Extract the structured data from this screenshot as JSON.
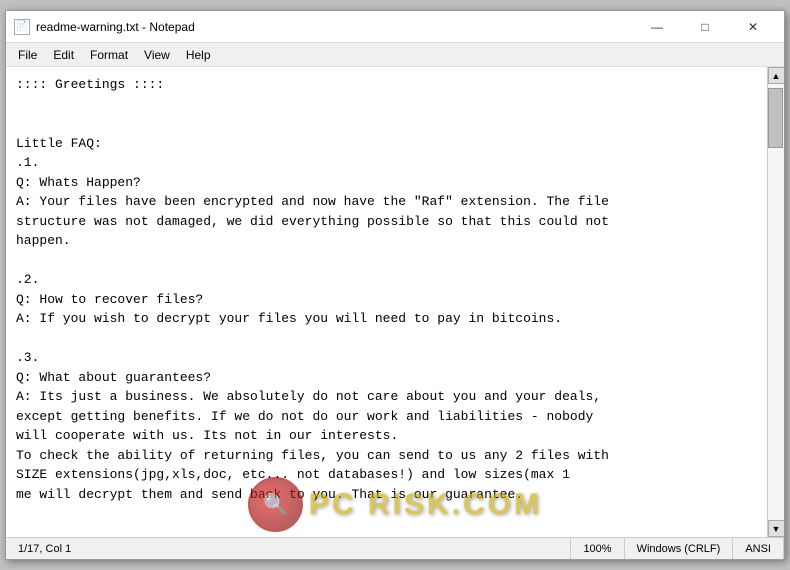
{
  "window": {
    "title": "readme-warning.txt - Notepad",
    "icon_char": "📄"
  },
  "title_buttons": {
    "minimize": "—",
    "maximize": "□",
    "close": "✕"
  },
  "menu": {
    "items": [
      "File",
      "Edit",
      "Format",
      "View",
      "Help"
    ]
  },
  "content": {
    "text": ":::: Greetings ::::\n\n\nLittle FAQ:\n.1.\nQ: Whats Happen?\nA: Your files have been encrypted and now have the \"Raf\" extension. The file\nstructure was not damaged, we did everything possible so that this could not\nhappen.\n\n.2.\nQ: How to recover files?\nA: If you wish to decrypt your files you will need to pay in bitcoins.\n\n.3.\nQ: What about guarantees?\nA: Its just a business. We absolutely do not care about you and your deals,\nexcept getting benefits. If we do not do our work and liabilities - nobody\nwill cooperate with us. Its not in our interests.\nTo check the ability of returning files, you can send to us any 2 files with\nSIZE extensions(jpg,xls,doc, etc... not databases!) and low sizes(max 1\nme will decrypt them and send back to you. That is our guarantee."
  },
  "status_bar": {
    "position": "1/17, Col 1",
    "zoom": "100%",
    "line_ending": "Windows (CRLF)",
    "encoding": "ANSI"
  },
  "watermark": {
    "icon_text": "🔍",
    "text": "PC RISK.COM"
  }
}
